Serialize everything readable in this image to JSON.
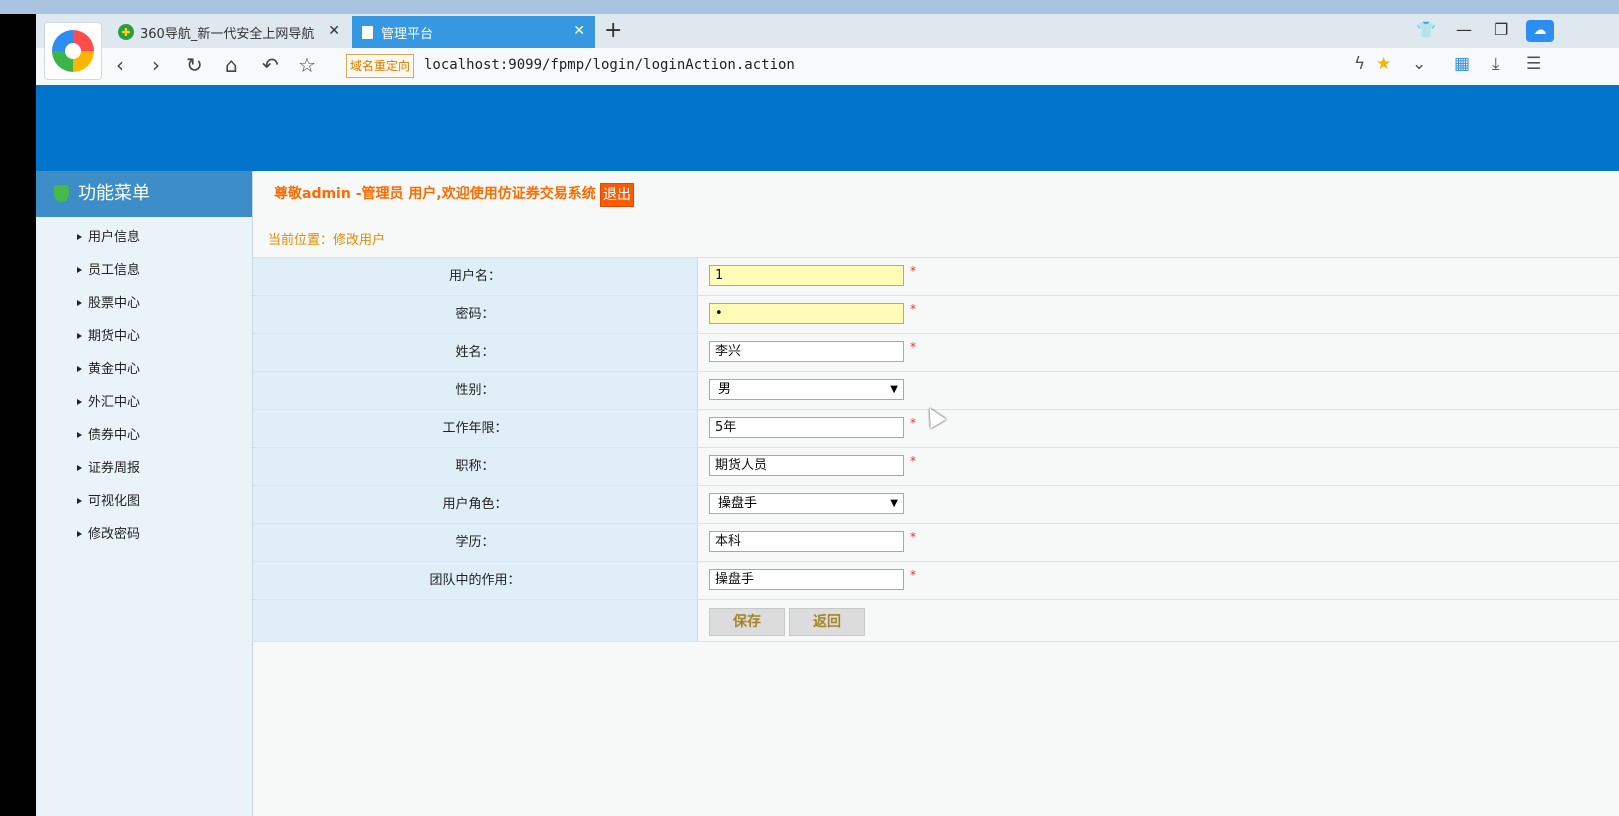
{
  "browser": {
    "tabs": [
      {
        "title": "360导航_新一代安全上网导航",
        "close": "✕"
      },
      {
        "title": "管理平台",
        "close": "✕"
      }
    ],
    "new_tab": "+",
    "redirect_badge": "域名重定向",
    "url": "localhost:9099/fpmp/login/loginAction.action"
  },
  "sidebar": {
    "title": "功能菜单",
    "items": [
      "用户信息",
      "员工信息",
      "股票中心",
      "期货中心",
      "黄金中心",
      "外汇中心",
      "债券中心",
      "证券周报",
      "可视化图",
      "修改密码"
    ]
  },
  "header_bar": {
    "welcome": "尊敬admin -管理员 用户,欢迎使用仿证券交易系统",
    "logout": "退出"
  },
  "breadcrumb": "当前位置：修改用户",
  "form": {
    "username_label": "用户名：",
    "username_value": "1",
    "password_label": "密码：",
    "password_value": "•",
    "name_label": "姓名：",
    "name_value": "李兴",
    "gender_label": "性别：",
    "gender_value": "男",
    "years_label": "工作年限：",
    "years_value": "5年",
    "title_label": "职称：",
    "title_value": "期货人员",
    "role_label": "用户角色：",
    "role_value": "操盘手",
    "edu_label": "学历：",
    "edu_value": "本科",
    "team_label": "团队中的作用：",
    "team_value": "操盘手",
    "required_mark": "*",
    "save": "保存",
    "back": "返回"
  },
  "colors": {
    "header_blue": "#0174cb",
    "sidebar_head": "#3d8ec8",
    "accent_orange": "#ff6a00",
    "label_bg": "#dfeef7"
  }
}
